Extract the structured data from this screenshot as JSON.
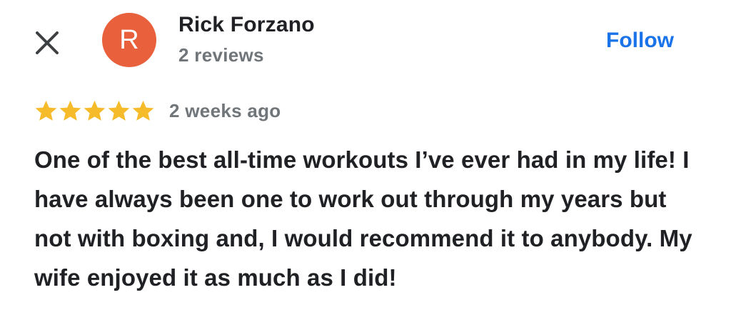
{
  "header": {
    "close_icon": "close-icon",
    "avatar_initial": "R",
    "avatar_color": "#e8603c",
    "reviewer_name": "Rick Forzano",
    "reviewer_subtitle": "2 reviews",
    "follow_label": "Follow",
    "accent_color": "#1a73e8"
  },
  "review": {
    "rating": 5,
    "rating_max": 5,
    "star_color": "#f6bb2b",
    "star_icon": "star-icon",
    "date": "2 weeks ago",
    "text": "One of the best all-time workouts I’ve ever had in my life! I have always been one to work out through my years but not with boxing and, I would recommend it to anybody. My wife enjoyed it as much as I did!"
  }
}
